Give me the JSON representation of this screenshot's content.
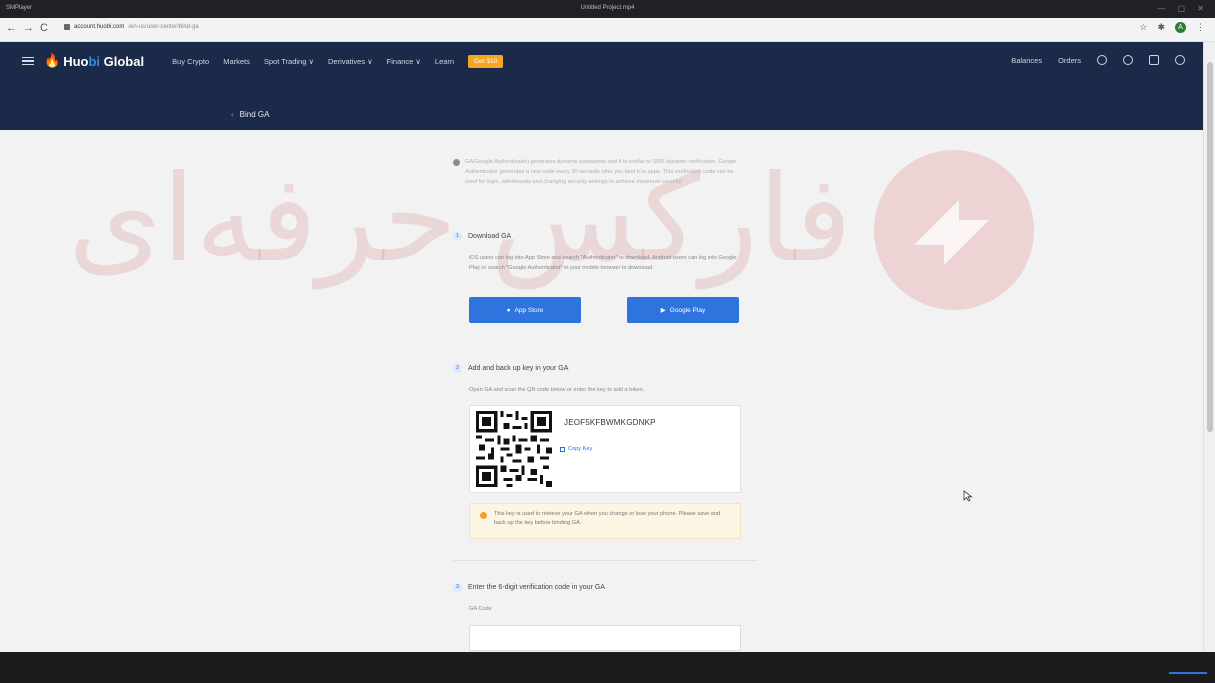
{
  "window": {
    "player": "SMPlayer",
    "title": "Untitled Project.mp4"
  },
  "browser": {
    "domain": "account.huobi.com",
    "path": "/en-us/user-center/bind-ga",
    "profile_initial": "A"
  },
  "header": {
    "logo_mark": "🔥",
    "logo_a": "Huo",
    "logo_b": "bi",
    "logo_c": " Global",
    "menu": [
      "Buy Crypto",
      "Markets",
      "Spot Trading ∨",
      "Derivatives ∨",
      "Finance ∨",
      "Learn"
    ],
    "badge": "Get $10",
    "right": [
      "Balances",
      "Orders"
    ],
    "page_title": "Bind GA"
  },
  "notice": "GA(Google Authenticator) generates dynamic passwords and it is similar to SMS dynamic verification. Google Authenticator generates a new code every 30 seconds after you bind it to apps. This verification code can be used for login, withdrawals and changing security settings to achieve maximum security.",
  "step1": {
    "num": "1",
    "title": "Download GA",
    "text": "iOS users can log into App Store and search \"Authenticator\" to download. Android users can log into Google Play or search \"Google Authenticator\" in your mobile browser to download.",
    "app_store": "App Store",
    "google_play": "Google Play"
  },
  "step2": {
    "num": "2",
    "title": "Add and back up key in your GA",
    "text": "Open GA and scan the QR code below or enter the key to add a token.",
    "key": "JEOF5KFBWMKGDNKP",
    "copy": "Copy Key",
    "warning": "This key is used to retrieve your GA when you change or lose your phone. Please save and back up the key before binding GA."
  },
  "step3": {
    "num": "3",
    "title": "Enter the 6-digit verification code in your GA",
    "label": "GA Code"
  },
  "watermark": {
    "left": "حرفه‌ای",
    "mid": "فارکس"
  },
  "colors": {
    "header": "#1b2a48",
    "accent": "#2f73df",
    "badge": "#f5a623"
  }
}
